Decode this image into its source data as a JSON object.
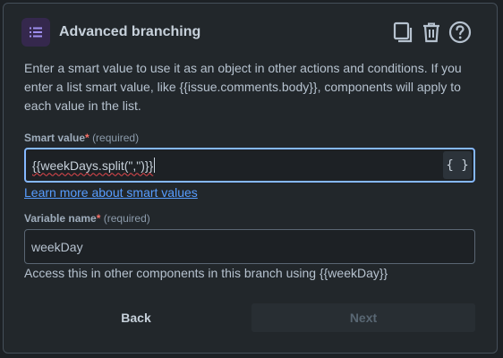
{
  "header": {
    "title": "Advanced branching",
    "icons": {
      "branch": "list-branch-icon",
      "copy": "copy-icon",
      "delete": "trash-icon",
      "help": "help-circle-icon"
    }
  },
  "description": "Enter a smart value to use it as an object in other actions and conditions. If you enter a list smart value, like {{issue.comments.body}}, components will apply to each value in the list.",
  "smart_value": {
    "label": "Smart value",
    "required_star": "*",
    "required_text": "(required)",
    "value": "{{weekDays.split(\",\")}}",
    "brace_button": "{ }",
    "link": "Learn more about smart values"
  },
  "variable_name": {
    "label": "Variable name",
    "required_star": "*",
    "required_text": "(required)",
    "value": "weekDay",
    "helper": "Access this in other components in this branch using {{weekDay}}"
  },
  "buttons": {
    "back": "Back",
    "next": "Next"
  },
  "colors": {
    "panel": "#22272b",
    "accent_focus": "#85b8ff",
    "link": "#579dff",
    "required": "#f87168",
    "icon_bg": "#35284d"
  }
}
